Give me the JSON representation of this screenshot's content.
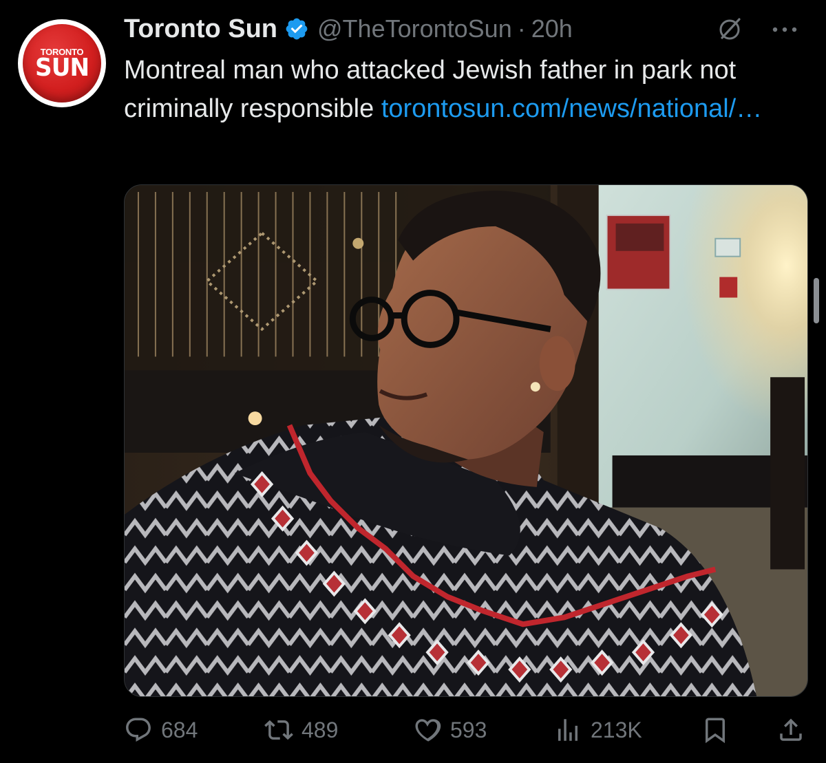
{
  "author": {
    "avatar_small_text": "TORONTO",
    "avatar_big_text": "SUN",
    "name": "Toronto Sun",
    "handle": "@TheTorontoSun",
    "separator": "·",
    "time": "20h",
    "verified_color": "#1d9bf0",
    "avatar_color": "#d21f1f"
  },
  "tweet": {
    "text": "Montreal man who attacked Jewish father in park not criminally responsible",
    "link_text": "torontosun.com/news/national/…",
    "link_color": "#1d9bf0",
    "media_icon": "photo"
  },
  "actions": {
    "replies": "684",
    "reposts": "489",
    "likes": "593",
    "views": "213K",
    "reply_icon": "reply-icon",
    "repost_icon": "repost-icon",
    "like_icon": "heart-icon",
    "views_icon": "views-icon",
    "bookmark_icon": "bookmark-icon",
    "share_icon": "share-icon"
  },
  "colors": {
    "background": "#000000",
    "text": "#e7e9ea",
    "muted": "#71767b"
  }
}
